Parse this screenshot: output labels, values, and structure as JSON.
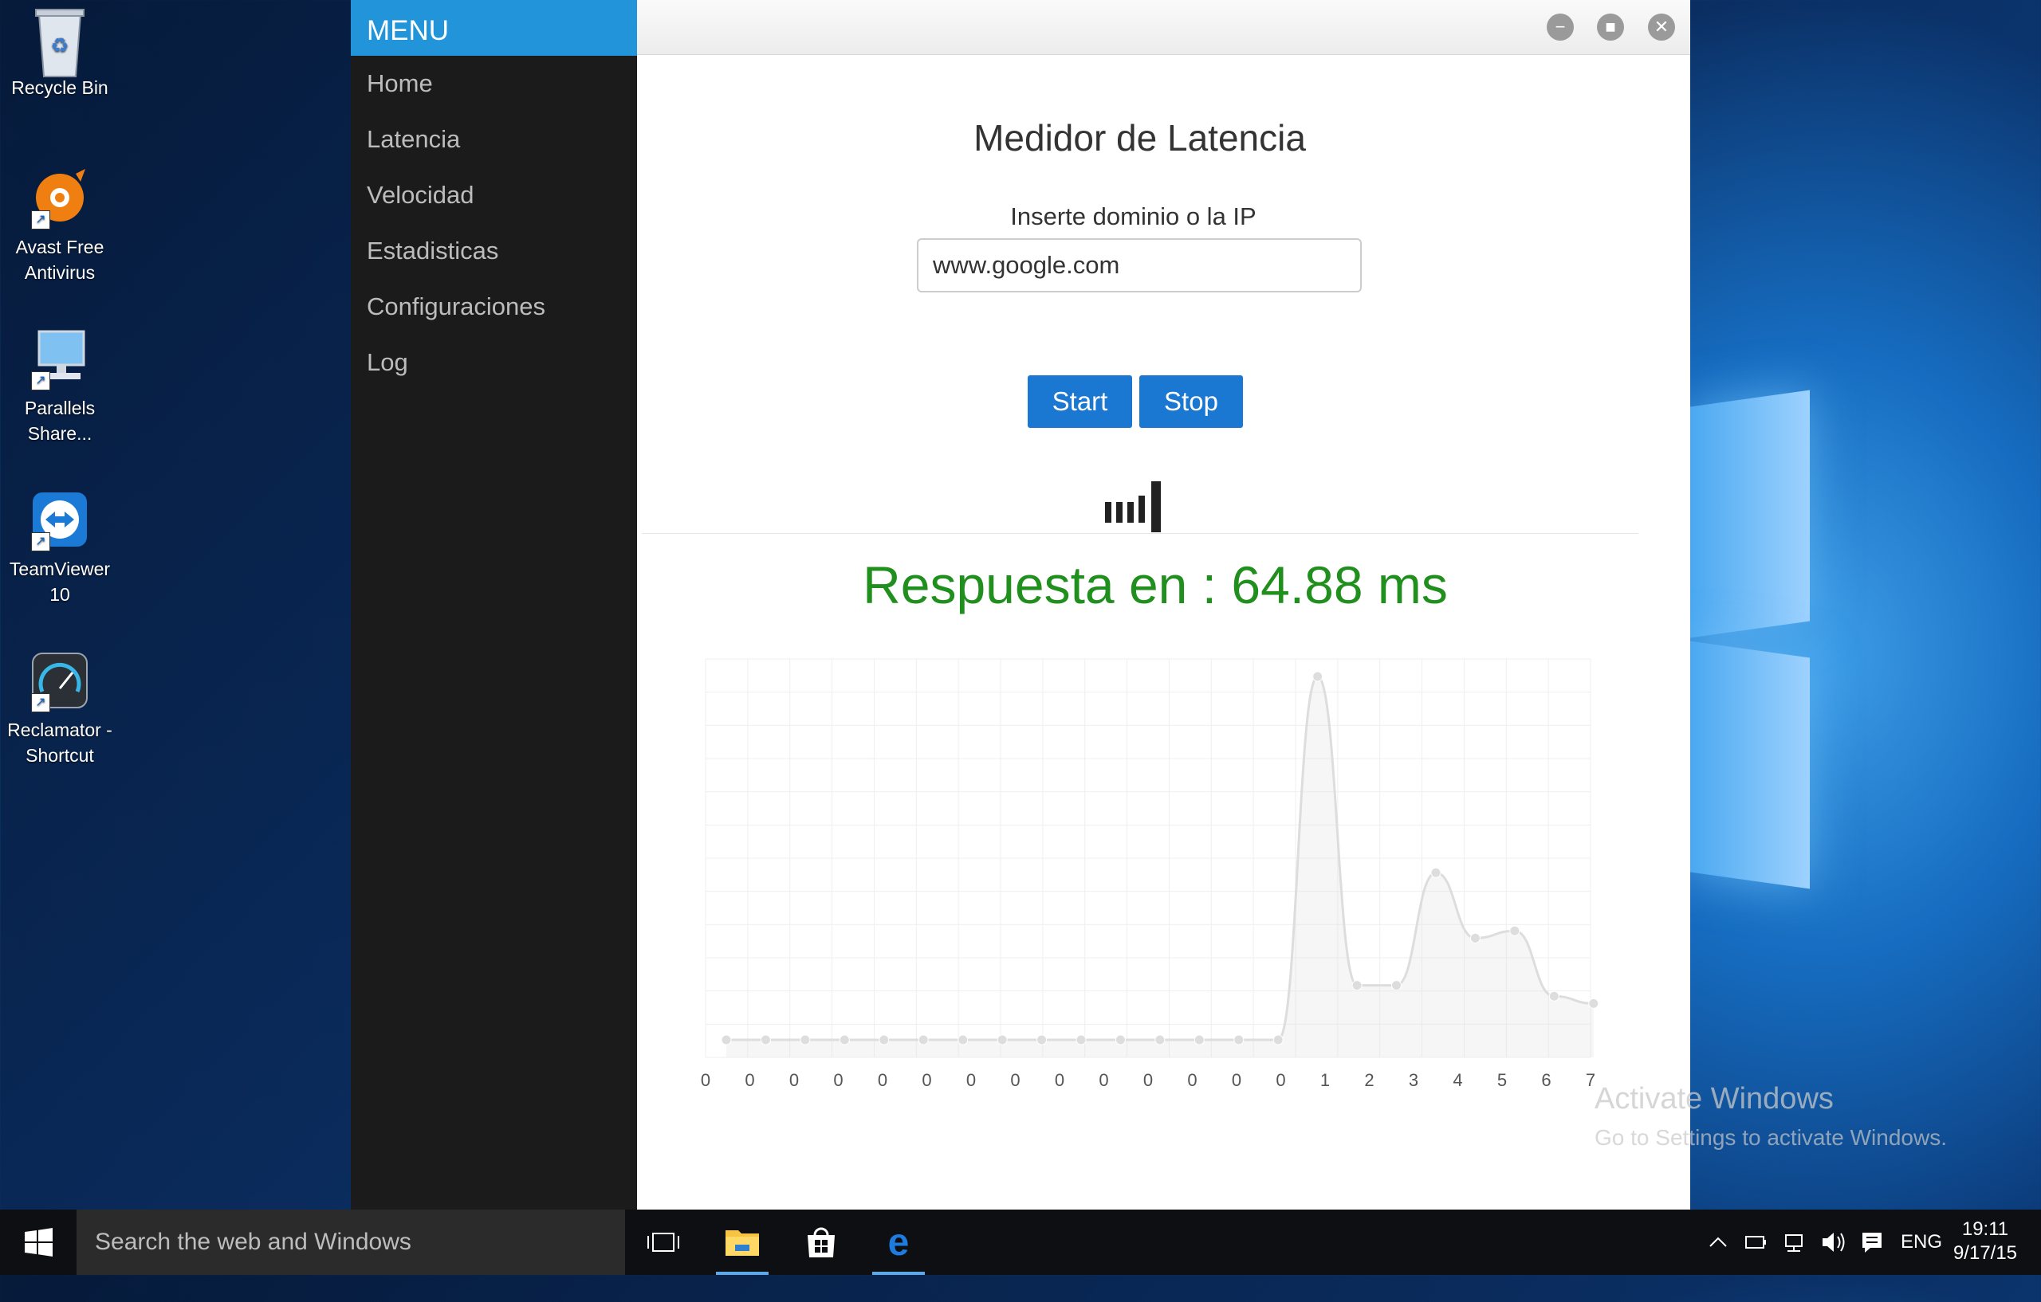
{
  "desktop": {
    "icons": [
      {
        "label": "Recycle Bin"
      },
      {
        "label": "Avast Free Antivirus"
      },
      {
        "label": "Parallels Share..."
      },
      {
        "label": "TeamViewer 10"
      },
      {
        "label": "Reclamator - Shortcut"
      }
    ],
    "watermark_title": "Activate Windows",
    "watermark_sub": "Go to Settings to activate Windows."
  },
  "sidebar": {
    "header": "MENU",
    "items": [
      {
        "label": "Home"
      },
      {
        "label": "Latencia"
      },
      {
        "label": "Velocidad"
      },
      {
        "label": "Estadisticas"
      },
      {
        "label": "Configuraciones"
      },
      {
        "label": "Log"
      }
    ]
  },
  "main": {
    "title": "Medidor de Latencia",
    "field_label": "Inserte dominio o la IP",
    "input_value": "www.google.com",
    "start_label": "Start",
    "stop_label": "Stop",
    "response": "Respuesta en : 64.88 ms"
  },
  "chart_data": {
    "type": "line",
    "x": [
      "0",
      "0",
      "0",
      "0",
      "0",
      "0",
      "0",
      "0",
      "0",
      "0",
      "0",
      "0",
      "0",
      "0",
      "1",
      "2",
      "3",
      "4",
      "5",
      "6",
      "7"
    ],
    "values": [
      0,
      0,
      0,
      0,
      0,
      0,
      0,
      0,
      0,
      0,
      0,
      0,
      0,
      0,
      0,
      100,
      15,
      15,
      46,
      28,
      30,
      12,
      10
    ],
    "series_color": "#dddddd",
    "grid": true
  },
  "taskbar": {
    "search_placeholder": "Search the web and Windows",
    "language": "ENG",
    "time": "19:11",
    "date": "9/17/15"
  }
}
